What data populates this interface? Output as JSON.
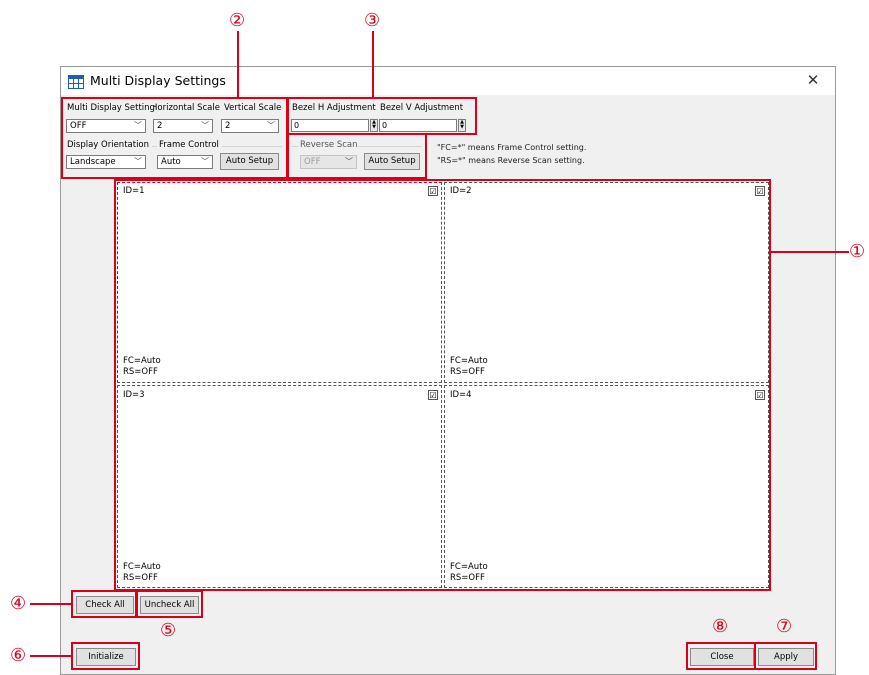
{
  "window": {
    "title": "Multi Display Settings",
    "close_icon": "close-icon"
  },
  "settings": {
    "multi_display_setting_label": "Multi Display Setting",
    "multi_display_setting_value": "OFF",
    "horizontal_scale_label": "Horizontal Scale",
    "horizontal_scale_value": "2",
    "vertical_scale_label": "Vertical Scale",
    "vertical_scale_value": "2",
    "display_orientation_label": "Display Orientation",
    "display_orientation_value": "Landscape",
    "frame_control_label": "Frame Control",
    "frame_control_value": "Auto",
    "auto_setup_label": "Auto Setup",
    "bezel_h_label": "Bezel H Adjustment",
    "bezel_h_value": "0",
    "bezel_v_label": "Bezel V Adjustment",
    "bezel_v_value": "0",
    "reverse_scan_label": "Reverse Scan",
    "reverse_scan_value": "OFF",
    "reverse_auto_setup_label": "Auto Setup",
    "hint_fc": "\"FC=*\" means Frame Control setting.",
    "hint_rs": "\"RS=*\" means Reverse Scan setting."
  },
  "displays": [
    {
      "id": "ID=1",
      "fc": "FC=Auto",
      "rs": "RS=OFF",
      "checked": "☑"
    },
    {
      "id": "ID=2",
      "fc": "FC=Auto",
      "rs": "RS=OFF",
      "checked": "☑"
    },
    {
      "id": "ID=3",
      "fc": "FC=Auto",
      "rs": "RS=OFF",
      "checked": "☑"
    },
    {
      "id": "ID=4",
      "fc": "FC=Auto",
      "rs": "RS=OFF",
      "checked": "☑"
    }
  ],
  "buttons": {
    "check_all": "Check All",
    "uncheck_all": "Uncheck All",
    "initialize": "Initialize",
    "close": "Close",
    "apply": "Apply"
  },
  "callouts": [
    "①",
    "②",
    "③",
    "④",
    "⑤",
    "⑥",
    "⑦",
    "⑧"
  ],
  "colors": {
    "callout": "#d9001b",
    "window_bg": "#f0f0f0"
  }
}
